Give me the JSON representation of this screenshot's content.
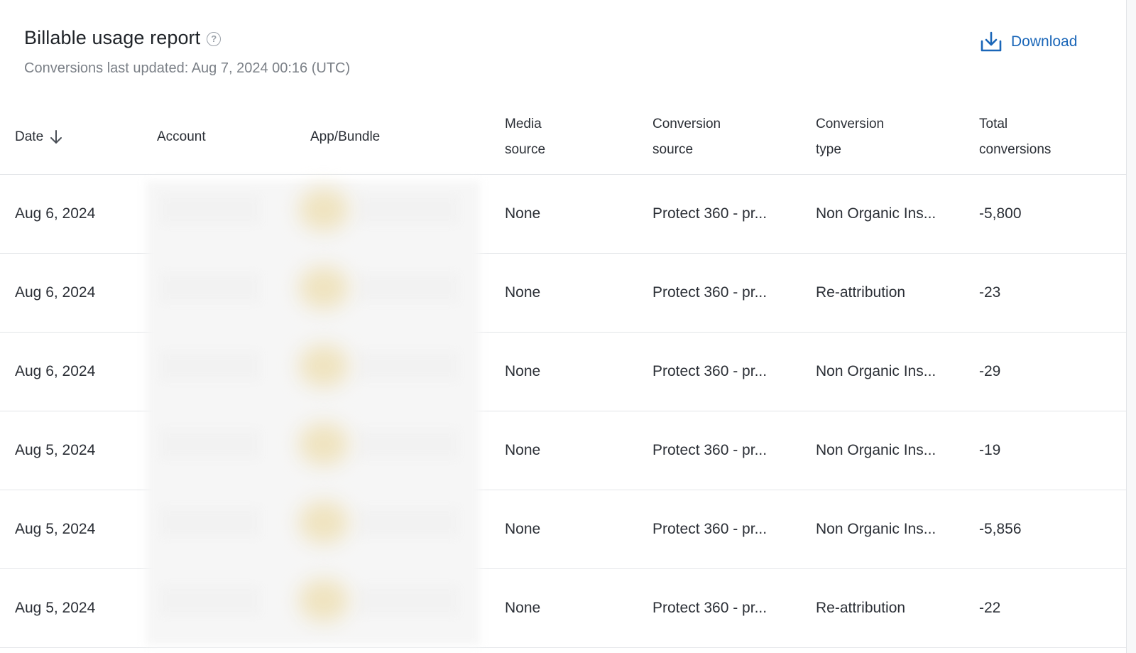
{
  "report": {
    "title": "Billable usage report",
    "last_updated": "Conversions last updated: Aug 7, 2024 00:16 (UTC)",
    "download_label": "Download"
  },
  "icons": {
    "help": "help-circle-icon",
    "download": "download-icon",
    "sort": "arrow-down-icon"
  },
  "colors": {
    "link": "#1a66b8"
  },
  "table": {
    "headers": {
      "date": "Date",
      "account": "Account",
      "app_bundle": "App/Bundle",
      "media_source_1": "Media",
      "media_source_2": "source",
      "conversion_source_1": "Conversion",
      "conversion_source_2": "source",
      "conversion_type_1": "Conversion",
      "conversion_type_2": "type",
      "total_conversions_1": "Total",
      "total_conversions_2": "conversions"
    },
    "rows": [
      {
        "date": "Aug 6, 2024",
        "media_source": "None",
        "conversion_source": "Protect 360 - pr...",
        "conversion_type": "Non Organic Ins...",
        "total": "-5,800"
      },
      {
        "date": "Aug 6, 2024",
        "media_source": "None",
        "conversion_source": "Protect 360 - pr...",
        "conversion_type": "Re-attribution",
        "total": "-23"
      },
      {
        "date": "Aug 6, 2024",
        "media_source": "None",
        "conversion_source": "Protect 360 - pr...",
        "conversion_type": "Non Organic Ins...",
        "total": "-29"
      },
      {
        "date": "Aug 5, 2024",
        "media_source": "None",
        "conversion_source": "Protect 360 - pr...",
        "conversion_type": "Non Organic Ins...",
        "total": "-19"
      },
      {
        "date": "Aug 5, 2024",
        "media_source": "None",
        "conversion_source": "Protect 360 - pr...",
        "conversion_type": "Non Organic Ins...",
        "total": "-5,856"
      },
      {
        "date": "Aug 5, 2024",
        "media_source": "None",
        "conversion_source": "Protect 360 - pr...",
        "conversion_type": "Re-attribution",
        "total": "-22"
      }
    ]
  }
}
